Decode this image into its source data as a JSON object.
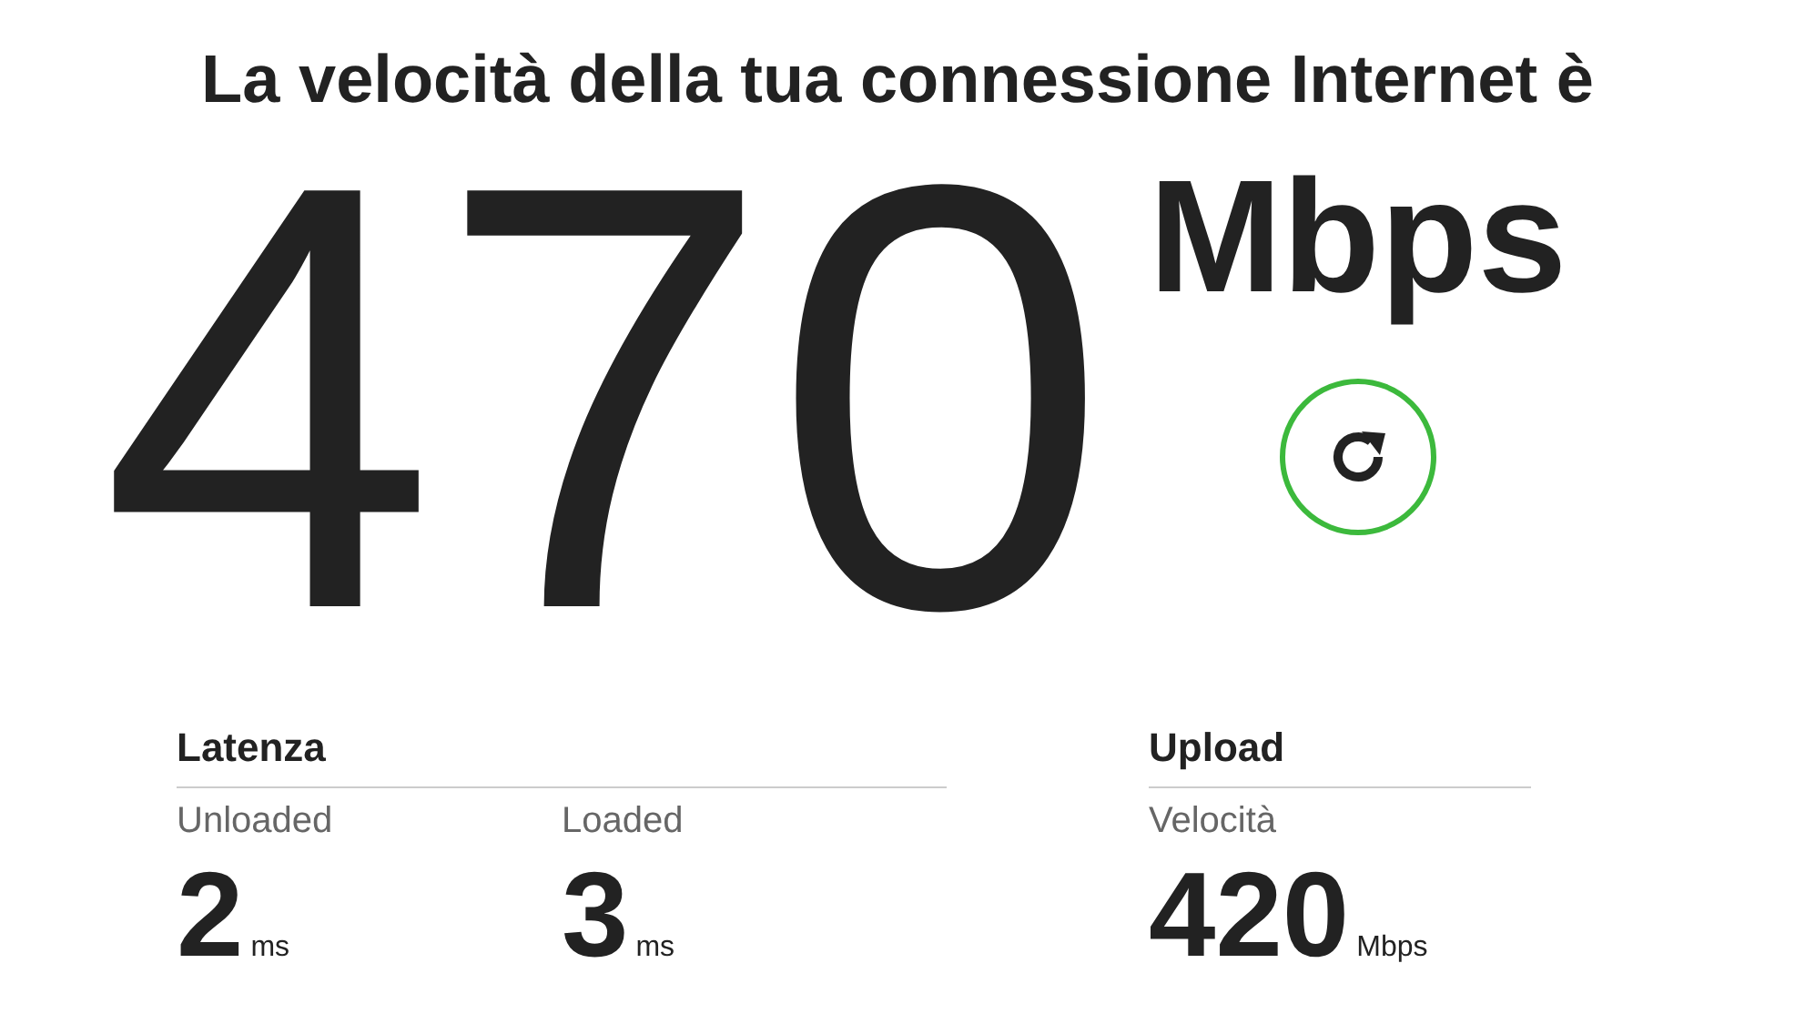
{
  "heading": "La velocità della tua connessione Internet è",
  "speed": {
    "value": "470",
    "unit": "Mbps"
  },
  "sections": [
    {
      "title": "Latenza",
      "metrics": [
        {
          "label": "Unloaded",
          "value": "2",
          "unit": "ms"
        },
        {
          "label": "Loaded",
          "value": "3",
          "unit": "ms"
        }
      ]
    },
    {
      "title": "Upload",
      "metrics": [
        {
          "label": "Velocità",
          "value": "420",
          "unit": "Mbps"
        }
      ]
    }
  ]
}
